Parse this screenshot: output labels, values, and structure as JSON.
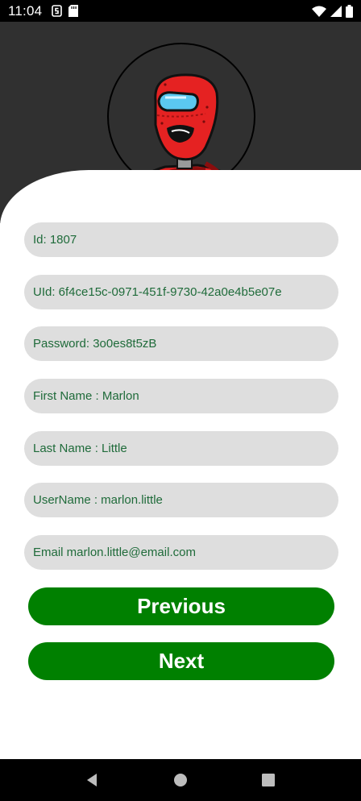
{
  "status_bar": {
    "time": "11:04",
    "icons": [
      "sim-card-s-icon",
      "sd-card-icon",
      "wifi-icon",
      "signal-icon",
      "battery-icon"
    ]
  },
  "profile": {
    "avatar_icon": "robot-avatar-icon"
  },
  "fields": {
    "id": "Id: 1807",
    "uid": "UId: 6f4ce15c-0971-451f-9730-42a0e4b5e07e",
    "password": "Password: 3o0es8t5zB",
    "first_name": "First Name : Marlon",
    "last_name": "Last Name : Little",
    "username": "UserName : marlon.little",
    "email": "Email marlon.little@email.com"
  },
  "buttons": {
    "previous": "Previous",
    "next": "Next"
  },
  "nav_bar": {
    "icons": [
      "back-icon",
      "home-icon",
      "recents-icon"
    ]
  },
  "colors": {
    "header_bg": "#303030",
    "field_bg": "#dedede",
    "field_text": "#1f6b3a",
    "button_bg": "#008000",
    "button_text": "#ffffff"
  }
}
